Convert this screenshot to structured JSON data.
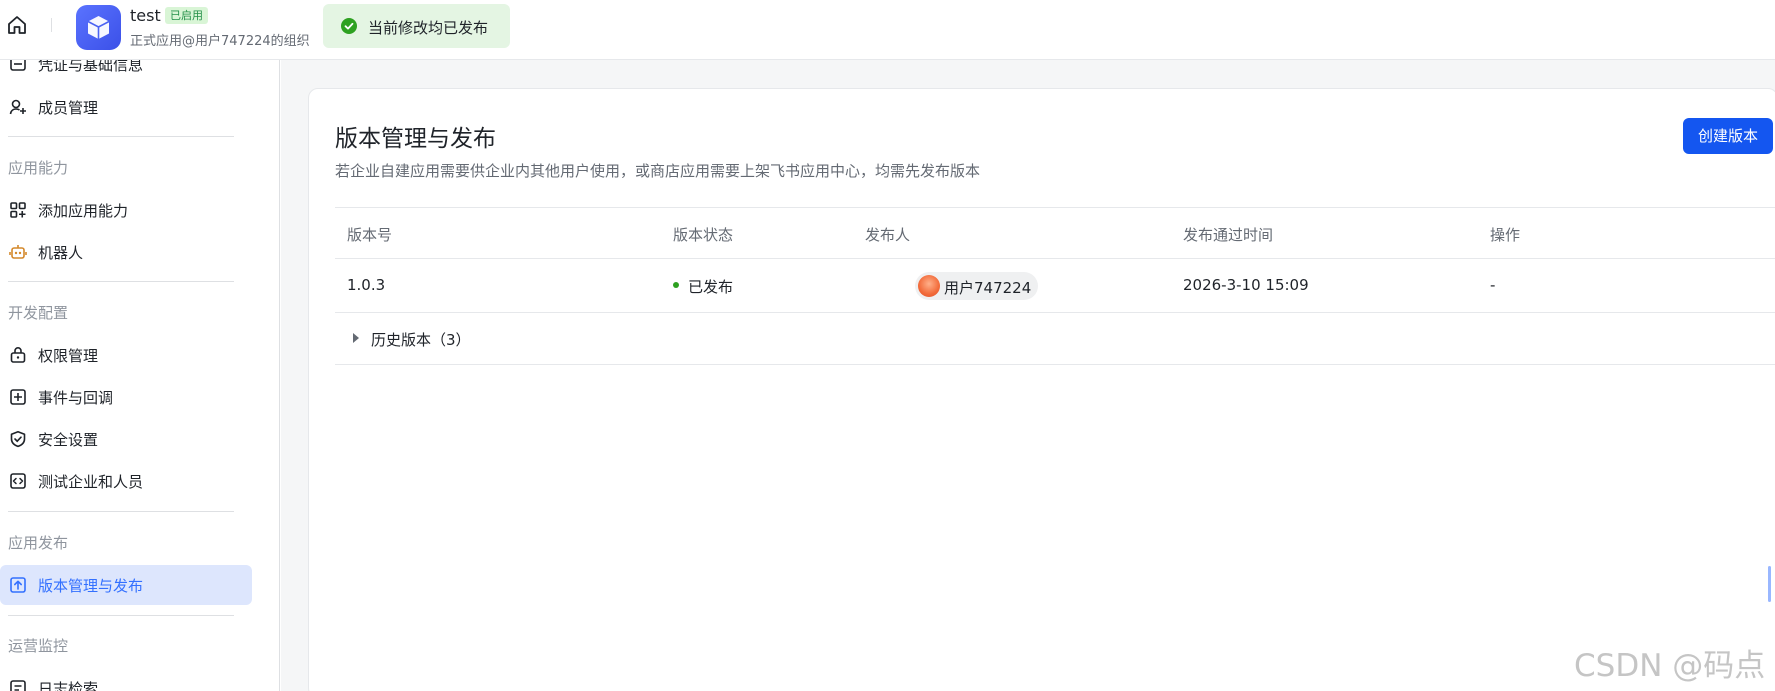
{
  "header": {
    "app_name": "test",
    "app_badge": "已启用",
    "app_sub": "正式应用@用户747224的组织"
  },
  "toast": {
    "text": "当前修改均已发布"
  },
  "sidebar": {
    "items": [
      {
        "label": "凭证与基础信息",
        "icon": "credential-icon"
      },
      {
        "label": "成员管理",
        "icon": "member-add-icon"
      },
      {
        "label": "添加应用能力",
        "icon": "add-capability-icon"
      },
      {
        "label": "机器人",
        "icon": "robot-icon"
      },
      {
        "label": "权限管理",
        "icon": "lock-icon"
      },
      {
        "label": "事件与回调",
        "icon": "event-icon"
      },
      {
        "label": "安全设置",
        "icon": "shield-icon"
      },
      {
        "label": "测试企业和人员",
        "icon": "code-icon"
      },
      {
        "label": "版本管理与发布",
        "icon": "upload-icon"
      },
      {
        "label": "日志检索",
        "icon": "log-icon"
      }
    ],
    "groups": [
      "应用能力",
      "开发配置",
      "应用发布",
      "运营监控"
    ],
    "active_color": "#3370ff"
  },
  "main": {
    "title": "版本管理与发布",
    "description": "若企业自建应用需要供企业内其他用户使用，或商店应用需要上架飞书应用中心，均需先发布版本",
    "create_button": "创建版本",
    "table": {
      "headers": [
        "版本号",
        "版本状态",
        "发布人",
        "发布通过时间",
        "操作"
      ],
      "rows": [
        {
          "version": "1.0.3",
          "status": "已发布",
          "publisher": "用户747224",
          "time": "2026-3-10 15:09",
          "action": "-"
        }
      ]
    },
    "history": "历史版本（3）"
  },
  "watermark": "CSDN @码点"
}
